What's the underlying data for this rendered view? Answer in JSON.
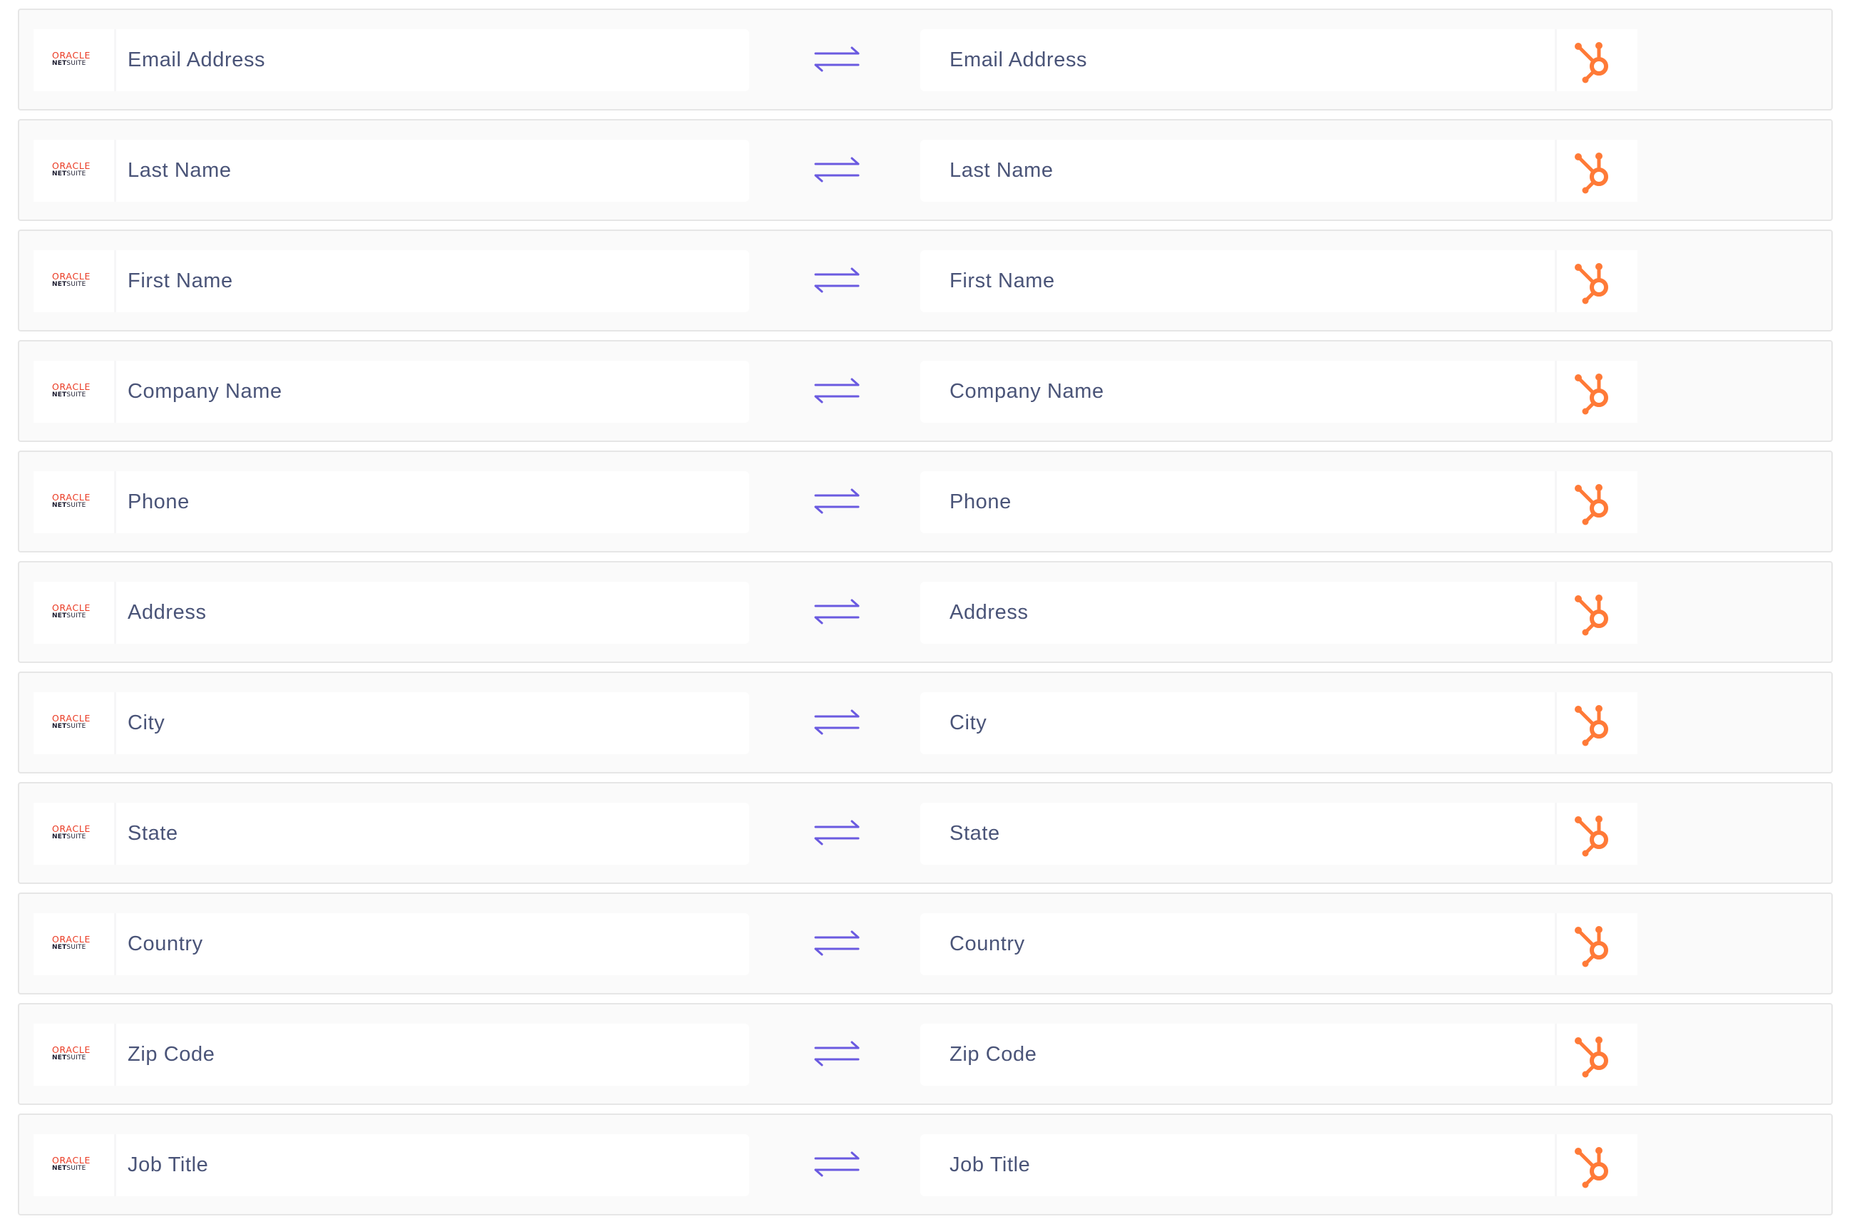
{
  "source_app": {
    "brand_top": "ORACLE",
    "brand_bottom_bold": "NET",
    "brand_bottom_light": "SUITE",
    "brand_color": "#ea3b24",
    "icon": "oracle-netsuite-logo"
  },
  "target_app": {
    "icon": "hubspot-sprocket-icon",
    "brand_color": "#ff7a37"
  },
  "sync_icon": {
    "icon": "bidirectional-arrows-icon",
    "color": "#6a5ae0"
  },
  "mappings": [
    {
      "source": "Email Address",
      "target": "Email Address"
    },
    {
      "source": "Last Name",
      "target": "Last Name"
    },
    {
      "source": "First Name",
      "target": "First Name"
    },
    {
      "source": "Company Name",
      "target": "Company Name"
    },
    {
      "source": "Phone",
      "target": "Phone"
    },
    {
      "source": "Address",
      "target": "Address"
    },
    {
      "source": "City",
      "target": "City"
    },
    {
      "source": "State",
      "target": "State"
    },
    {
      "source": "Country",
      "target": "Country"
    },
    {
      "source": "Zip Code",
      "target": "Zip Code"
    },
    {
      "source": "Job Title",
      "target": "Job Title"
    }
  ]
}
